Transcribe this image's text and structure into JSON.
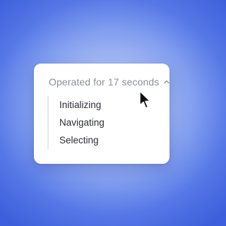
{
  "panel": {
    "header_label": "Operated for 17 seconds",
    "expanded": true,
    "chevron_icon": "chevron-up-icon",
    "steps": [
      {
        "label": "Initializing"
      },
      {
        "label": "Navigating"
      },
      {
        "label": "Selecting"
      }
    ]
  },
  "pointer": {
    "icon": "mouse-pointer-icon"
  },
  "colors": {
    "background_center": "#c9d6f7",
    "background_edge": "#3d5fdc",
    "card": "#ffffff",
    "header_text": "#8b8f98",
    "step_text": "#2c2f36"
  }
}
